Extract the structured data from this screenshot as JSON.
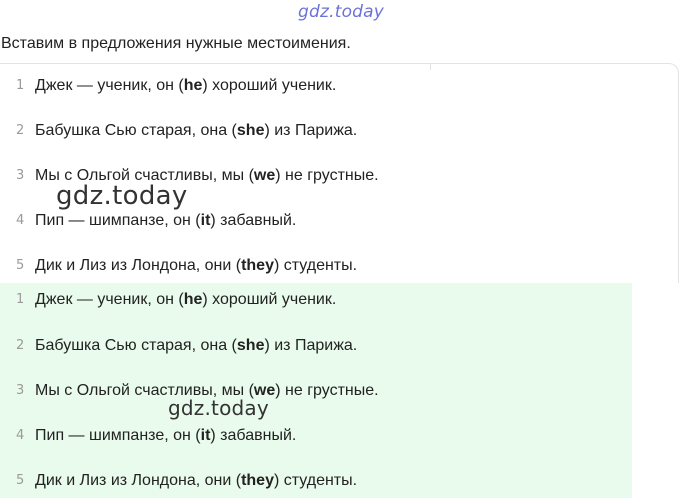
{
  "watermark_top": "gdz.today",
  "instruction": "Вставим в предложения нужные местоимения.",
  "watermark_big": "gdz.today",
  "watermark_mid": "gdz.today",
  "exercise": [
    {
      "num": "1",
      "before": "Джек — ученик, он (",
      "bold": "he",
      "after": ") хороший ученик."
    },
    {
      "num": "2",
      "before": "Бабушка Сью старая, она (",
      "bold": "she",
      "after": ") из Парижа."
    },
    {
      "num": "3",
      "before": "Мы с Ольгой счастливы, мы (",
      "bold": "we",
      "after": ") не грустные."
    },
    {
      "num": "4",
      "before": "Пип — шимпанзе, он (",
      "bold": "it",
      "after": ") забавный."
    },
    {
      "num": "5",
      "before": "Дик и Лиз из Лондона, они (",
      "bold": "they",
      "after": ") студенты."
    }
  ],
  "answers": [
    {
      "num": "1",
      "before": "Джек — ученик, он (",
      "bold": "he",
      "after": ") хороший ученик."
    },
    {
      "num": "2",
      "before": "Бабушка Сью старая, она (",
      "bold": "she",
      "after": ") из Парижа."
    },
    {
      "num": "3",
      "before": "Мы с Ольгой счастливы, мы (",
      "bold": "we",
      "after": ") не грустные."
    },
    {
      "num": "4",
      "before": "Пип — шимпанзе, он (",
      "bold": "it",
      "after": ") забавный."
    },
    {
      "num": "5",
      "before": "Дик и Лиз из Лондона, они (",
      "bold": "they",
      "after": ") студенты."
    }
  ]
}
